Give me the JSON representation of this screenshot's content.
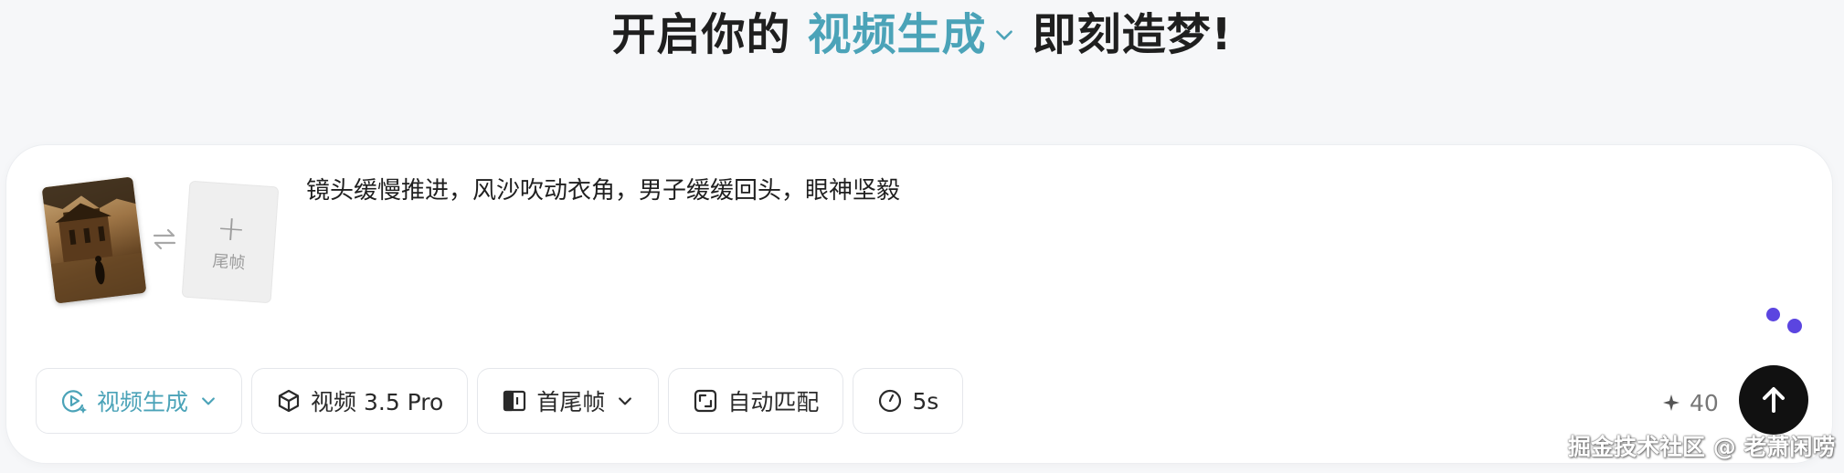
{
  "headline": {
    "prefix": "开启你的",
    "mode": "视频生成",
    "suffix": "即刻造梦!"
  },
  "frames": {
    "swap_icon": "swap-arrows-icon",
    "last_frame_plus": "+",
    "last_frame_label": "尾帧"
  },
  "prompt": {
    "text": "镜头缓慢推进，风沙吹动衣角，男子缓缓回头，眼神坚毅"
  },
  "toolbar": {
    "mode": {
      "label": "视频生成",
      "icon": "video-generate-icon"
    },
    "model": {
      "label": "视频 3.5 Pro",
      "icon": "cube-icon"
    },
    "frames_mode": {
      "label": "首尾帧",
      "icon": "frame-split-icon"
    },
    "ratio": {
      "label": "自动匹配",
      "icon": "aspect-ratio-icon"
    },
    "duration": {
      "label": "5s",
      "icon": "clock-icon"
    }
  },
  "credits": {
    "value": "40",
    "icon": "sparkle-icon"
  },
  "send": {
    "icon": "arrow-up-icon"
  },
  "watermark": {
    "text": "掘金技术社区 @ 老萧闲唠"
  },
  "colors": {
    "accent": "#4ba3b8",
    "loading_dots": "#5b45e0",
    "send_button": "#111111",
    "background": "#f6f7f9"
  }
}
